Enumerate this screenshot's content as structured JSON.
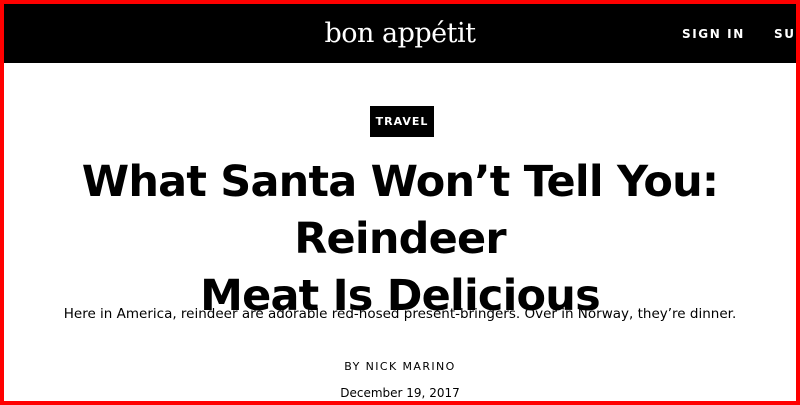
{
  "header": {
    "logo_text": "bon appétit",
    "nav": {
      "sign_in": "SIGN IN",
      "subscribe_truncated": "SU"
    }
  },
  "article": {
    "category": "TRAVEL",
    "headline_line1": "What Santa Won’t Tell You: Reindeer",
    "headline_line2": "Meat Is Delicious",
    "dek": "Here in America, reindeer are adorable red-nosed present-bringers. Over in Norway, they’re dinner.",
    "byline": "BY NICK MARINO",
    "date": "December 19, 2017"
  },
  "colors": {
    "header_bg": "#000000",
    "header_text": "#ffffff",
    "page_bg": "#ffffff",
    "text": "#000000",
    "frame_border": "#ff0000"
  }
}
